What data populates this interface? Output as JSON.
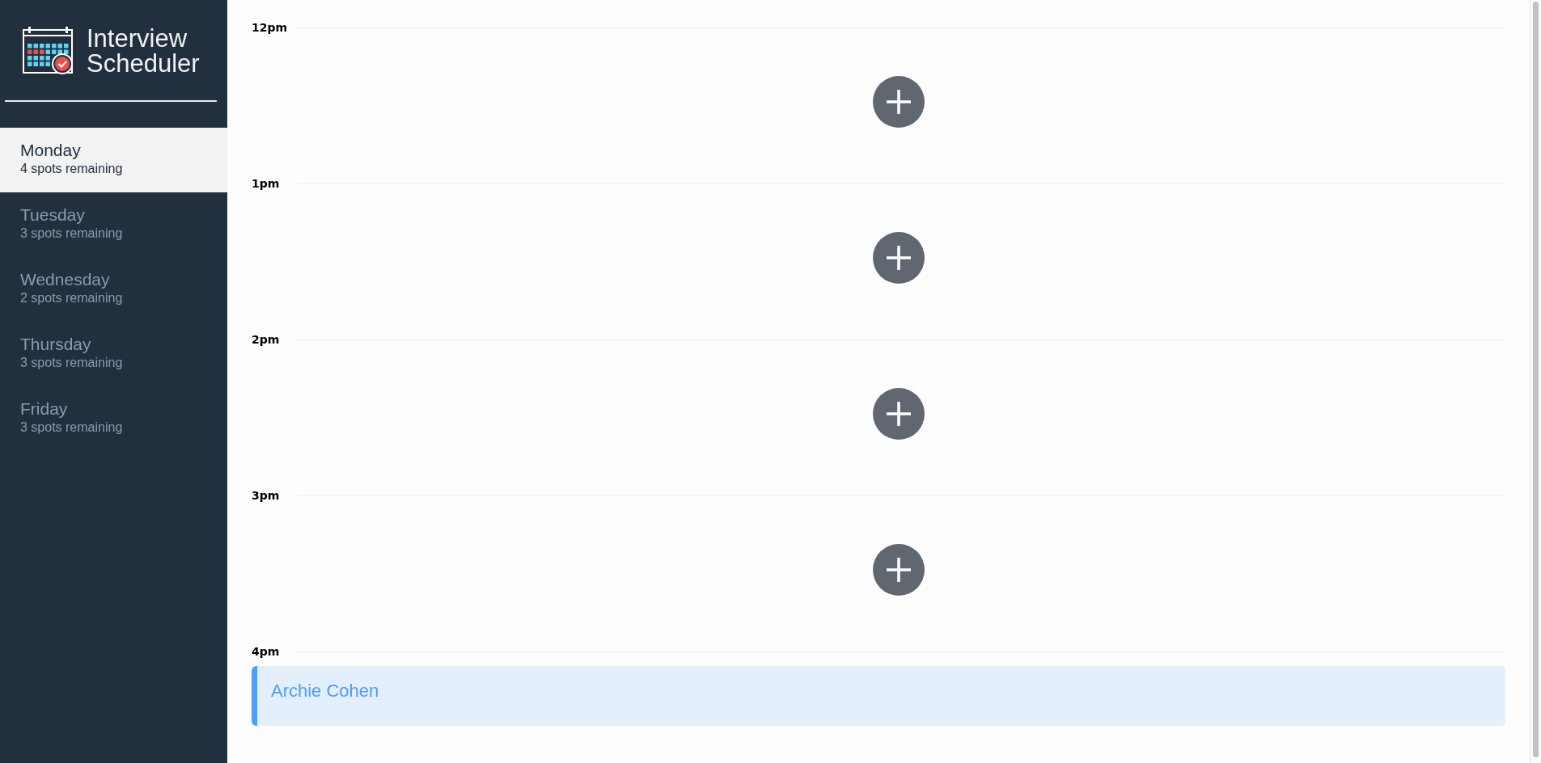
{
  "app": {
    "title": "Interview Scheduler"
  },
  "days": [
    {
      "name": "Monday",
      "spots": "4 spots remaining",
      "selected": true
    },
    {
      "name": "Tuesday",
      "spots": "3 spots remaining",
      "selected": false
    },
    {
      "name": "Wednesday",
      "spots": "2 spots remaining",
      "selected": false
    },
    {
      "name": "Thursday",
      "spots": "3 spots remaining",
      "selected": false
    },
    {
      "name": "Friday",
      "spots": "3 spots remaining",
      "selected": false
    }
  ],
  "slots": [
    {
      "time": "12pm",
      "kind": "empty"
    },
    {
      "time": "1pm",
      "kind": "empty"
    },
    {
      "time": "2pm",
      "kind": "empty"
    },
    {
      "time": "3pm",
      "kind": "empty"
    },
    {
      "time": "4pm",
      "kind": "booked",
      "student": "Archie Cohen"
    }
  ]
}
